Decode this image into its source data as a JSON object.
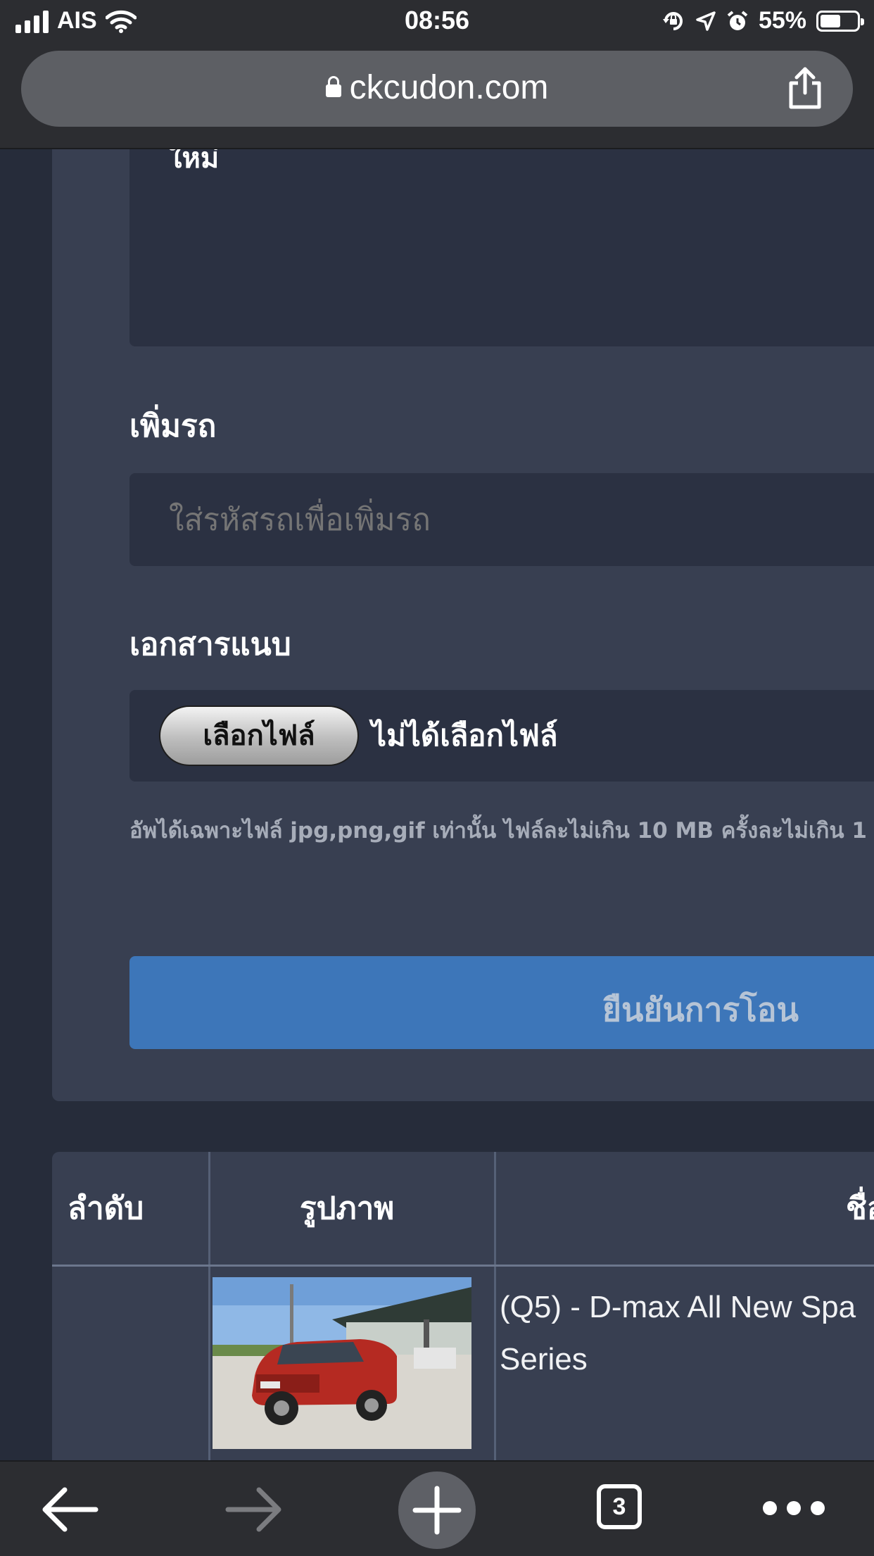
{
  "status_bar": {
    "carrier": "AIS",
    "time": "08:56",
    "battery_percent": "55%",
    "battery_level": 0.55
  },
  "browser": {
    "url": "ckcudon.com",
    "tab_count": "3"
  },
  "form": {
    "textarea_label_tail": "ใหม่",
    "add_car_label": "เพิ่มรถ",
    "add_car_placeholder": "ใส่รหัสรถเพื่อเพิ่มรถ",
    "attachment_label": "เอกสารแนบ",
    "choose_file_button": "เลือกไฟล์",
    "no_file_text": "ไม่ได้เลือกไฟล์",
    "file_hint": "อัพได้เฉพาะไฟล์ jpg,png,gif เท่านั้น ไฟล์ละไม่เกิน 10 MB ครั้งละไม่เกิน 1",
    "confirm_button": "ยืนยันการโอน"
  },
  "table": {
    "headers": [
      "ลำดับ",
      "รูปภาพ",
      "ชื่อ"
    ],
    "rows": [
      {
        "index": "",
        "name_line1": "(Q5) - D-max All New Spa",
        "name_line2": "Series"
      }
    ]
  },
  "colors": {
    "page_bg": "#262c3a",
    "card_bg": "#383f51",
    "input_bg": "#2b3142",
    "confirm_button": "#3d76b9",
    "browser_chrome": "#2c2d31"
  }
}
